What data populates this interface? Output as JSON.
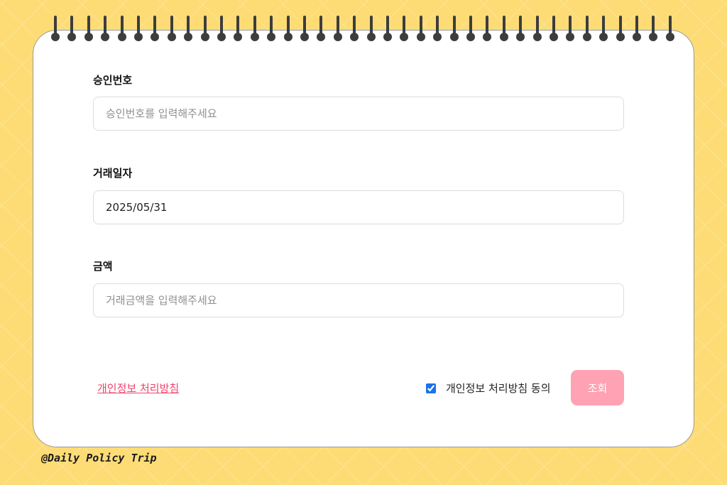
{
  "form": {
    "approval_number": {
      "label": "승인번호",
      "value": "",
      "placeholder": "승인번호를 입력해주세요"
    },
    "transaction_date": {
      "label": "거래일자",
      "value": "2025/05/31",
      "placeholder": ""
    },
    "amount": {
      "label": "금액",
      "value": "",
      "placeholder": "거래금액을 입력해주세요"
    }
  },
  "footer": {
    "privacy_link": "개인정보 처리방침",
    "consent_label": "개인정보 처리방침 동의",
    "consent_checked": true,
    "submit_label": "조회"
  },
  "watermark": "@Daily Policy Trip",
  "colors": {
    "background": "#fddc76",
    "link": "#f0426b",
    "submit_button": "#ffa2b3",
    "ring": "#3d3d3d"
  },
  "icons": {
    "binding": "spiral-ring-icon"
  }
}
